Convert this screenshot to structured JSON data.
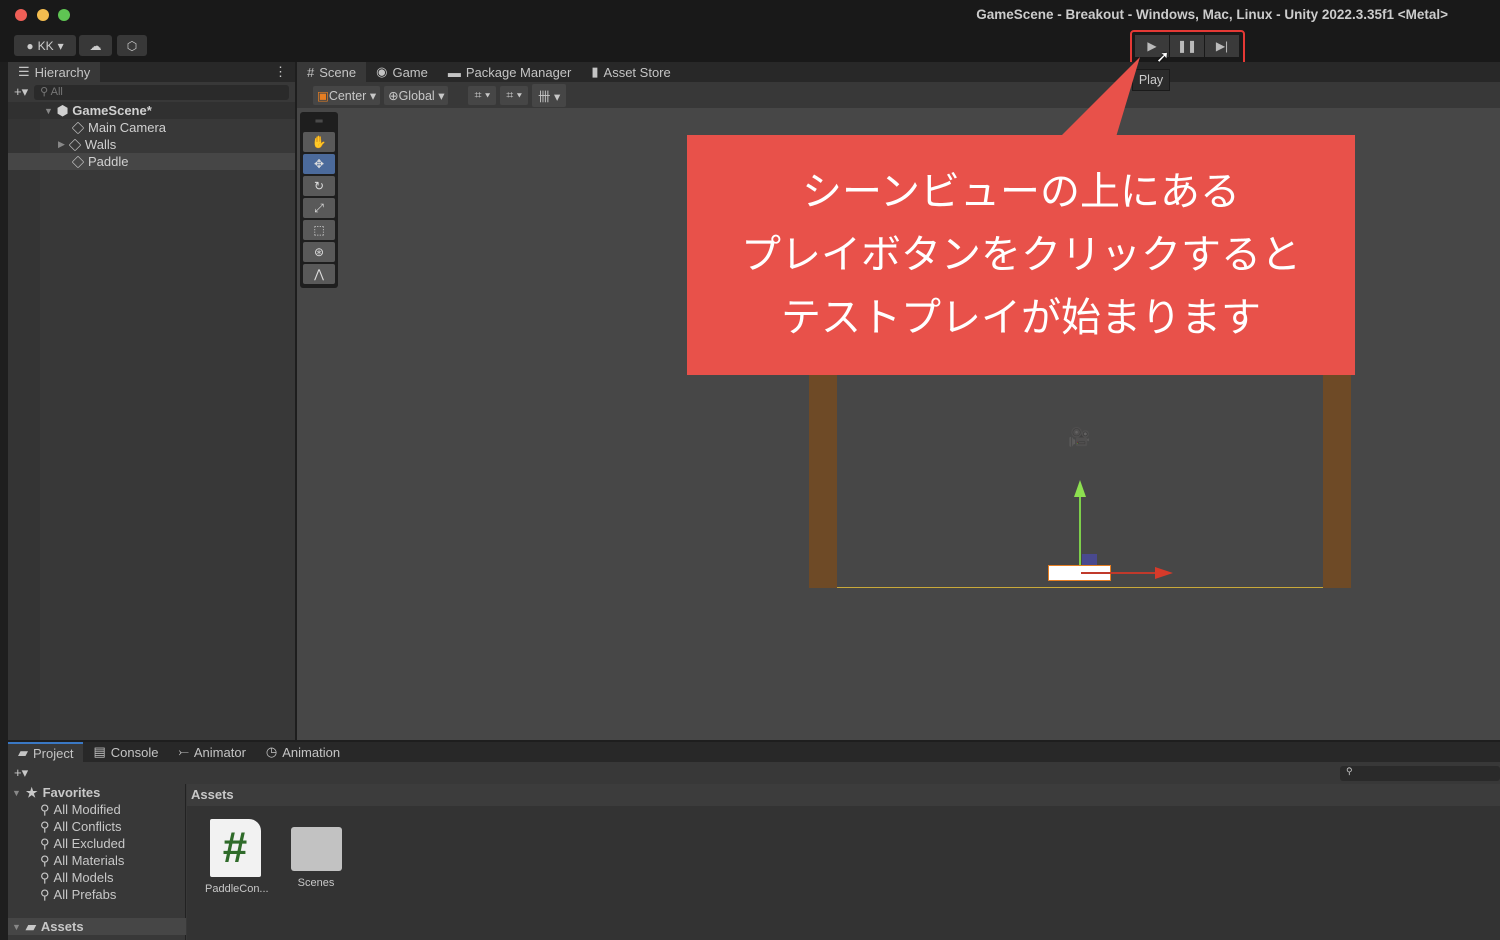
{
  "window": {
    "title": "GameScene - Breakout - Windows, Mac, Linux - Unity 2022.3.35f1 <Metal>"
  },
  "toolbar": {
    "account": "KK",
    "play_tooltip": "Play",
    "play_icon": "play-icon",
    "pause_icon": "pause-icon",
    "step_icon": "step-icon"
  },
  "hierarchy": {
    "tab": "Hierarchy",
    "search_placeholder": "All",
    "scene": "GameScene*",
    "items": [
      {
        "label": "Main Camera"
      },
      {
        "label": "Walls"
      },
      {
        "label": "Paddle"
      }
    ]
  },
  "scene_tabs": [
    {
      "label": "Scene"
    },
    {
      "label": "Game"
    },
    {
      "label": "Package Manager"
    },
    {
      "label": "Asset Store"
    }
  ],
  "scene_toolbar": {
    "pivot": "Center",
    "space": "Global"
  },
  "callout": {
    "lines": [
      "シーンビューの上にある",
      "プレイボタンをクリックすると",
      "テストプレイが始まります"
    ],
    "color": "#e8514a"
  },
  "bottom_tabs": [
    {
      "label": "Project"
    },
    {
      "label": "Console"
    },
    {
      "label": "Animator"
    },
    {
      "label": "Animation"
    }
  ],
  "project": {
    "favorites_label": "Favorites",
    "favorites": [
      "All Modified",
      "All Conflicts",
      "All Excluded",
      "All Materials",
      "All Models",
      "All Prefabs"
    ],
    "assets_label": "Assets",
    "assets_header": "Assets",
    "files": [
      {
        "label": "PaddleCon..."
      },
      {
        "label": "Scenes"
      }
    ]
  }
}
